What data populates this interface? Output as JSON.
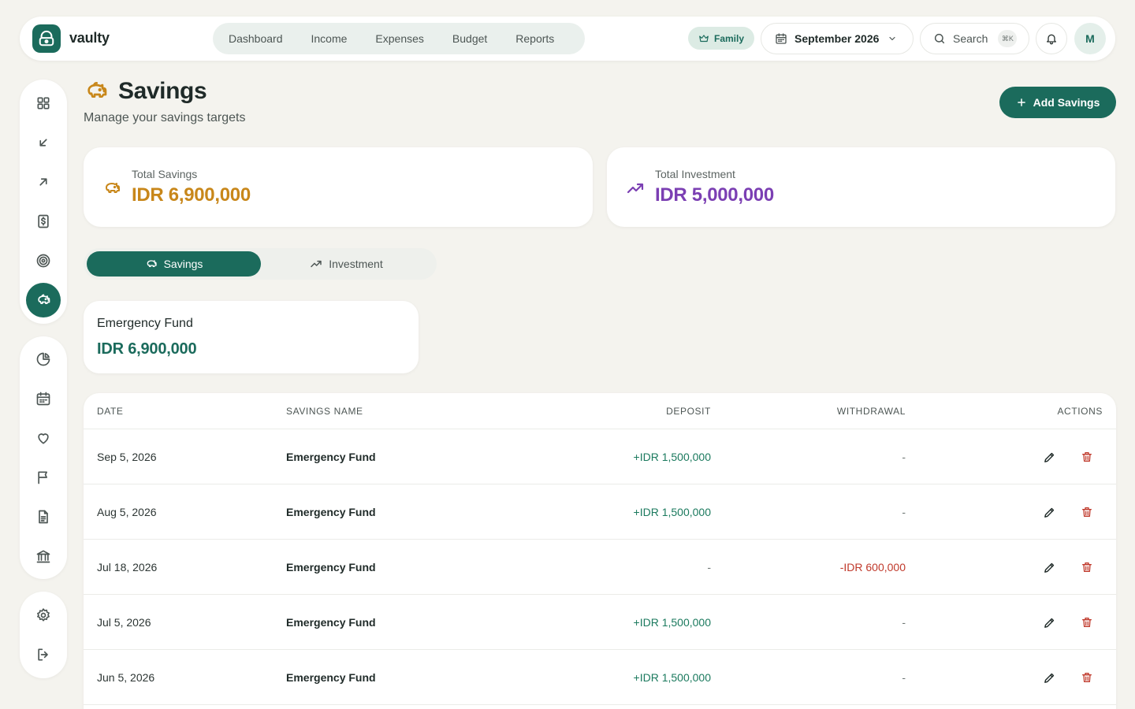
{
  "app": {
    "name": "vaulty"
  },
  "nav": {
    "items": [
      "Dashboard",
      "Income",
      "Expenses",
      "Budget",
      "Reports"
    ]
  },
  "topbar": {
    "family_label": "Family",
    "month": "September 2026",
    "search_label": "Search",
    "search_shortcut": "⌘K",
    "avatar_initial": "M"
  },
  "sidebar": {
    "items": [
      "grid-icon",
      "arrow-down-left-icon",
      "arrow-up-right-icon",
      "dollar-icon",
      "target-icon",
      "piggy-bank-icon",
      "pie-chart-icon",
      "calendar-icon",
      "heart-icon",
      "flag-icon",
      "document-icon",
      "bank-icon",
      "settings-icon",
      "logout-icon"
    ],
    "active": "piggy-bank-icon"
  },
  "page": {
    "title": "Savings",
    "subtitle": "Manage your savings targets",
    "add_button": "Add Savings"
  },
  "summary": {
    "savings": {
      "label": "Total Savings",
      "value": "IDR 6,900,000"
    },
    "investment": {
      "label": "Total Investment",
      "value": "IDR 5,000,000"
    }
  },
  "tabs": {
    "savings": "Savings",
    "investment": "Investment",
    "active": "savings"
  },
  "fund_card": {
    "name": "Emergency Fund",
    "value": "IDR 6,900,000"
  },
  "table": {
    "headers": {
      "date": "DATE",
      "name": "SAVINGS NAME",
      "deposit": "DEPOSIT",
      "withdrawal": "WITHDRAWAL",
      "actions": "ACTIONS"
    },
    "rows": [
      {
        "date": "Sep 5, 2026",
        "name": "Emergency Fund",
        "deposit": "+IDR 1,500,000",
        "withdrawal": "-"
      },
      {
        "date": "Aug 5, 2026",
        "name": "Emergency Fund",
        "deposit": "+IDR 1,500,000",
        "withdrawal": "-"
      },
      {
        "date": "Jul 18, 2026",
        "name": "Emergency Fund",
        "deposit": "-",
        "withdrawal": "-IDR 600,000"
      },
      {
        "date": "Jul 5, 2026",
        "name": "Emergency Fund",
        "deposit": "+IDR 1,500,000",
        "withdrawal": "-"
      },
      {
        "date": "Jun 5, 2026",
        "name": "Emergency Fund",
        "deposit": "+IDR 1,500,000",
        "withdrawal": "-"
      }
    ]
  },
  "colors": {
    "brand": "#1b6b5c",
    "savings_accent": "#c8871a",
    "investment_accent": "#7b3fb3",
    "deposit": "#1b7a5e",
    "withdrawal": "#c0392b",
    "background": "#f4f3ee"
  }
}
